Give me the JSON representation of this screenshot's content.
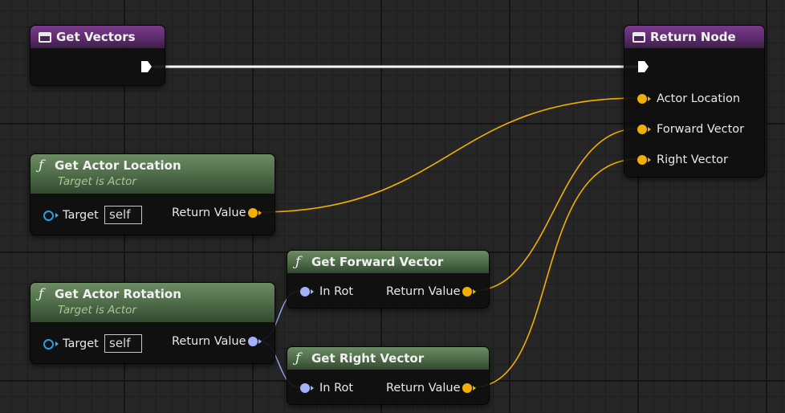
{
  "nodes": {
    "get_vectors": {
      "title": "Get Vectors"
    },
    "return_node": {
      "title": "Return Node",
      "pins": {
        "actor_location": "Actor Location",
        "forward_vector": "Forward Vector",
        "right_vector": "Right Vector"
      }
    },
    "get_actor_location": {
      "title": "Get Actor Location",
      "subtitle": "Target is Actor",
      "target_label": "Target",
      "target_value": "self",
      "return_label": "Return Value"
    },
    "get_actor_rotation": {
      "title": "Get Actor Rotation",
      "subtitle": "Target is Actor",
      "target_label": "Target",
      "target_value": "self",
      "return_label": "Return Value"
    },
    "get_forward_vector": {
      "title": "Get Forward Vector",
      "in_label": "In Rot",
      "return_label": "Return Value"
    },
    "get_right_vector": {
      "title": "Get Right Vector",
      "in_label": "In Rot",
      "return_label": "Return Value"
    }
  },
  "function_symbol": "ƒ",
  "colors": {
    "event_header": "#5a2a6a",
    "function_header": "#4c6a46",
    "vector_pin": "#f1b000",
    "rotator_pin": "#a4b1ff",
    "object_pin": "#2a9de0",
    "exec_wire": "#ffffff"
  }
}
